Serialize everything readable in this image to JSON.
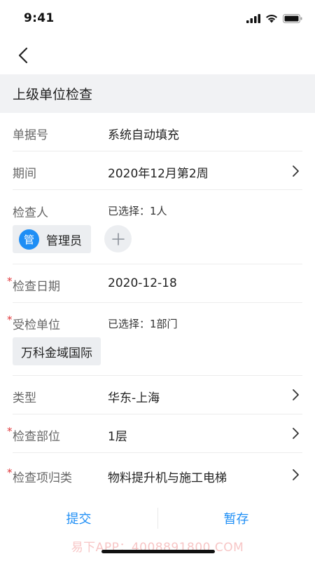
{
  "status_bar": {
    "time": "9:41"
  },
  "section": {
    "title": "上级单位检查"
  },
  "form": {
    "doc_no": {
      "label": "单据号",
      "value": "系统自动填充"
    },
    "period": {
      "label": "期间",
      "value": "2020年12月第2周"
    },
    "inspector": {
      "label": "检查人",
      "summary": "已选择：1人",
      "chips": [
        {
          "avatar": "管",
          "name": "管理员"
        }
      ]
    },
    "check_date": {
      "required_mark": "*",
      "label": "检查日期",
      "value": "2020-12-18"
    },
    "inspected_unit": {
      "required_mark": "*",
      "label": "受检单位",
      "summary": "已选择：1部门",
      "chips": [
        {
          "name": "万科金域国际"
        }
      ]
    },
    "type": {
      "label": "类型",
      "value": "华东-上海"
    },
    "part": {
      "required_mark": "*",
      "label": "检查部位",
      "value": "1层"
    },
    "category": {
      "required_mark": "*",
      "label": "检查项归类",
      "value": "物料提升机与施工电梯"
    }
  },
  "footer": {
    "submit_label": "提交",
    "save_label": "暂存",
    "watermark": "易下APP：4008891800.COM"
  },
  "colors": {
    "accent": "#1e8ef5",
    "required": "#e0383b",
    "header_bg": "#f1f2f4"
  }
}
